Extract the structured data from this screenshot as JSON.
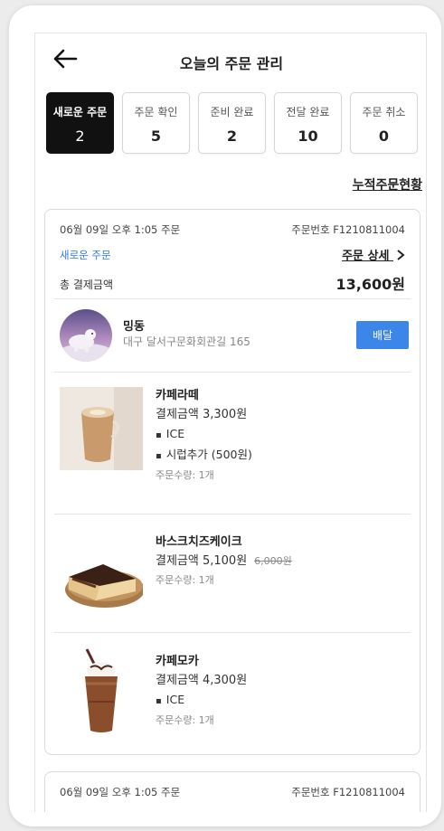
{
  "header": {
    "title": "오늘의 주문 관리",
    "back_icon": "arrow-left-icon"
  },
  "tabs": [
    {
      "label": "새로운 주문",
      "count": "2",
      "active": true
    },
    {
      "label": "주문 확인",
      "count": "5",
      "active": false
    },
    {
      "label": "준비 완료",
      "count": "2",
      "active": false
    },
    {
      "label": "전달 완료",
      "count": "10",
      "active": false
    },
    {
      "label": "주문 취소",
      "count": "0",
      "active": false
    }
  ],
  "cumulative_link": "누적주문현황",
  "orders": [
    {
      "datetime": "06월 09일 오후 1:05 주문",
      "order_number": "주문번호 F1210811004",
      "status": "새로운 주문",
      "detail_link": "주문 상세",
      "total_label": "총 결제금액",
      "total_value": "13,600원",
      "customer": {
        "name": "밍동",
        "address": "대구 달서구문화회관길 165"
      },
      "deliver_button": "배달",
      "items": [
        {
          "name": "카페라떼",
          "price": "결제금액 3,300원",
          "options": [
            "ICE",
            "시럽추가 (500원)"
          ],
          "quantity": "주문수량: 1개"
        },
        {
          "name": "바스크치즈케이크",
          "price": "결제금액 5,100원",
          "original_price": "6,000원",
          "quantity": "주문수량: 1개"
        },
        {
          "name": "카페모카",
          "price": "결제금액 4,300원",
          "options": [
            "ICE"
          ],
          "quantity": "주문수량: 1개"
        }
      ]
    },
    {
      "datetime": "06월 09일 오후 1:05 주문",
      "order_number": "주문번호 F1210811004"
    }
  ],
  "colors": {
    "accent_blue": "#3b86e8",
    "status_blue": "#2f7de1",
    "active_tab": "#111111"
  }
}
